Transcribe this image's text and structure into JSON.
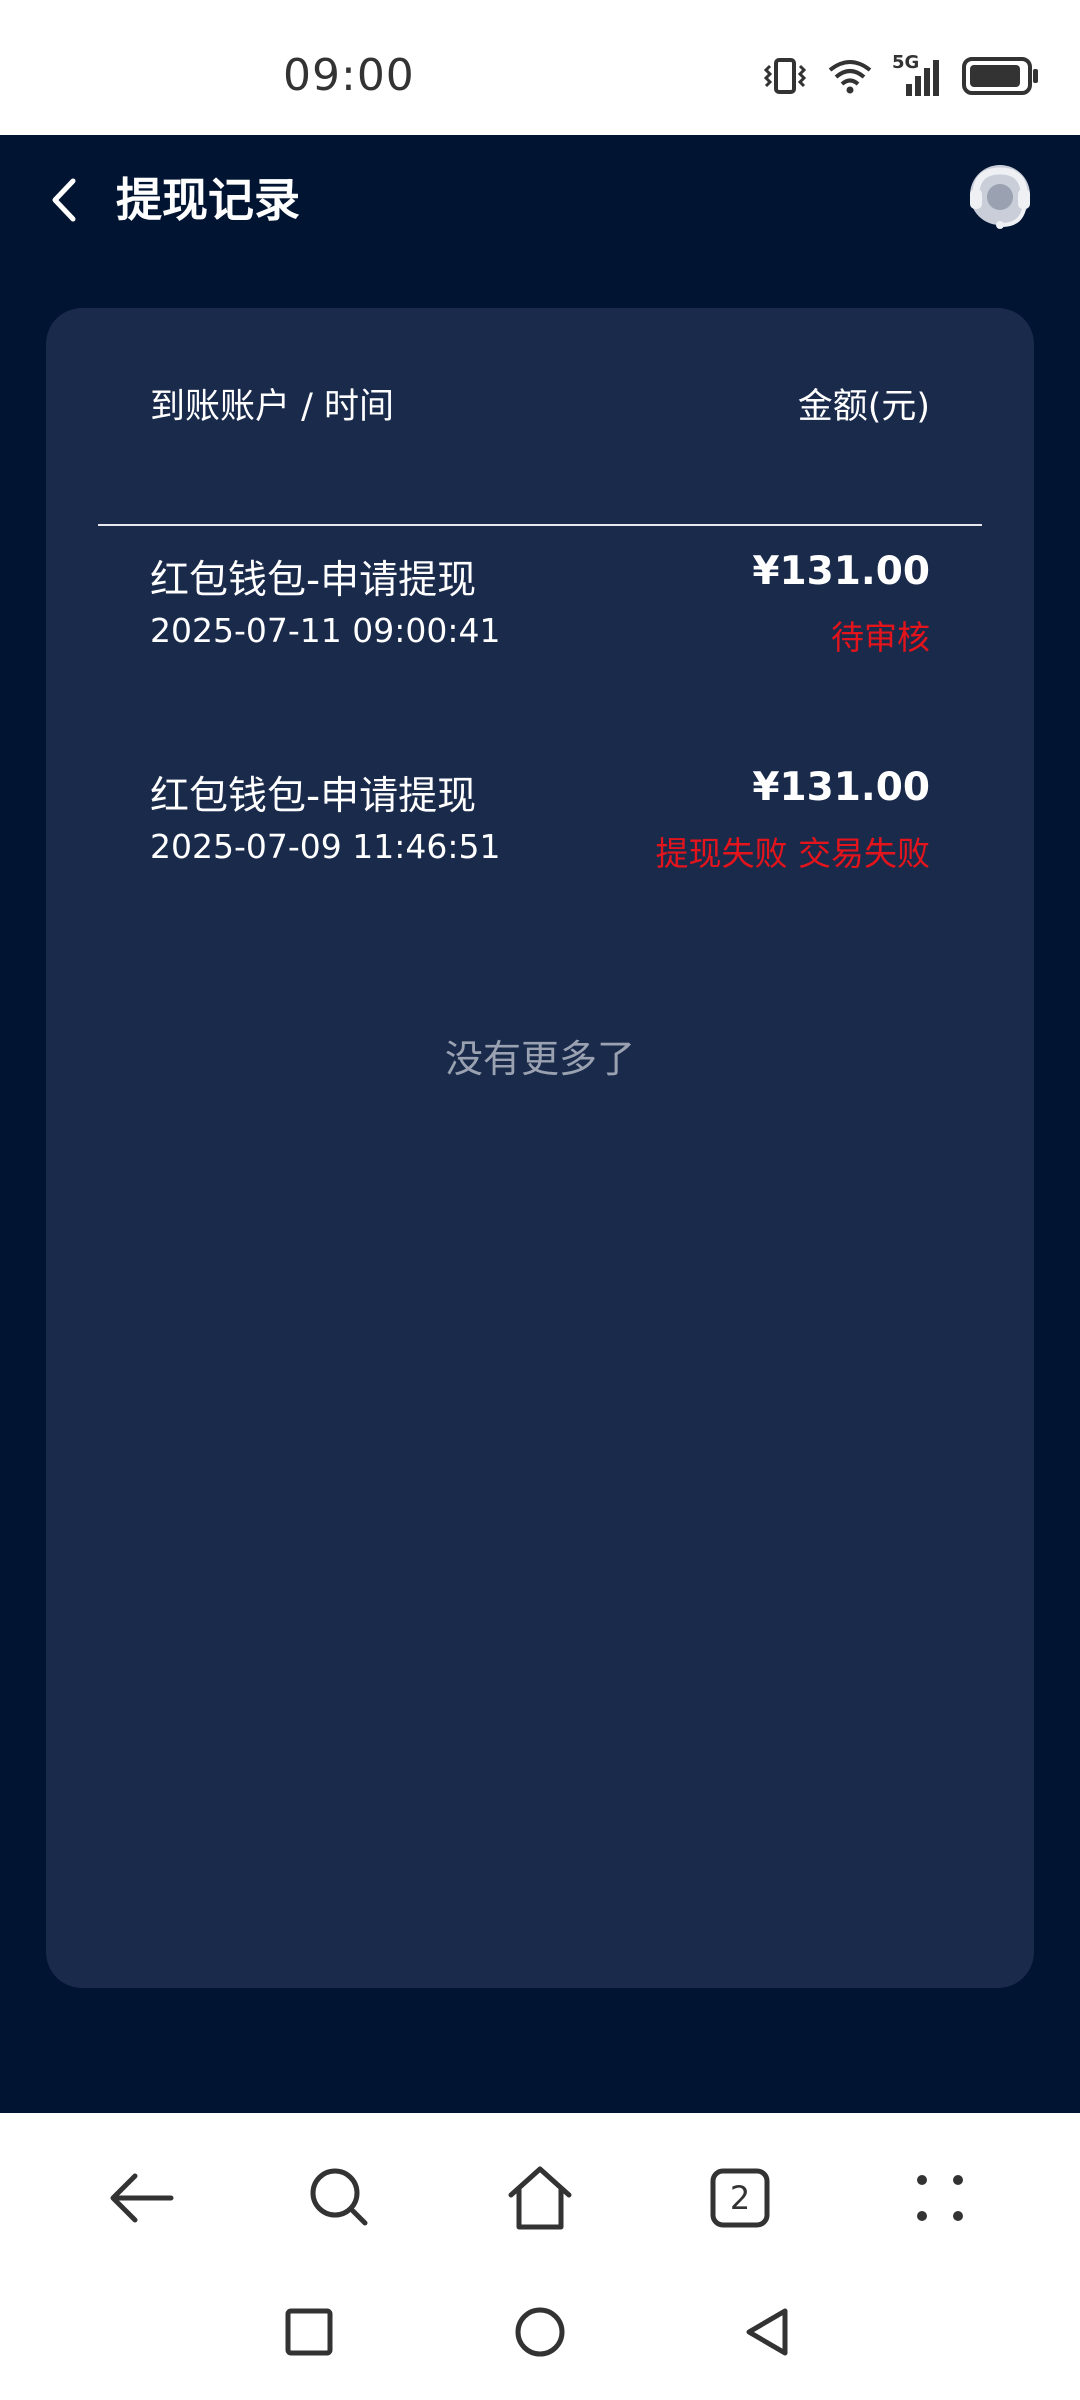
{
  "status_bar": {
    "time": "09:00",
    "network_label": "5G"
  },
  "header": {
    "title": "提现记录"
  },
  "table": {
    "header_left": "到账账户 / 时间",
    "header_right": "金额(元)"
  },
  "records": [
    {
      "title": "红包钱包-申请提现",
      "time": "2025-07-11 09:00:41",
      "amount": "¥131.00",
      "status": "待审核"
    },
    {
      "title": "红包钱包-申请提现",
      "time": "2025-07-09 11:46:51",
      "amount": "¥131.00",
      "status": "提现失败 交易失败"
    }
  ],
  "footer_text": "没有更多了",
  "browser_nav": {
    "tab_count": "2"
  },
  "colors": {
    "app_background": "#011432",
    "card_background": "#1a2a4b",
    "status_red": "#e3141c"
  }
}
